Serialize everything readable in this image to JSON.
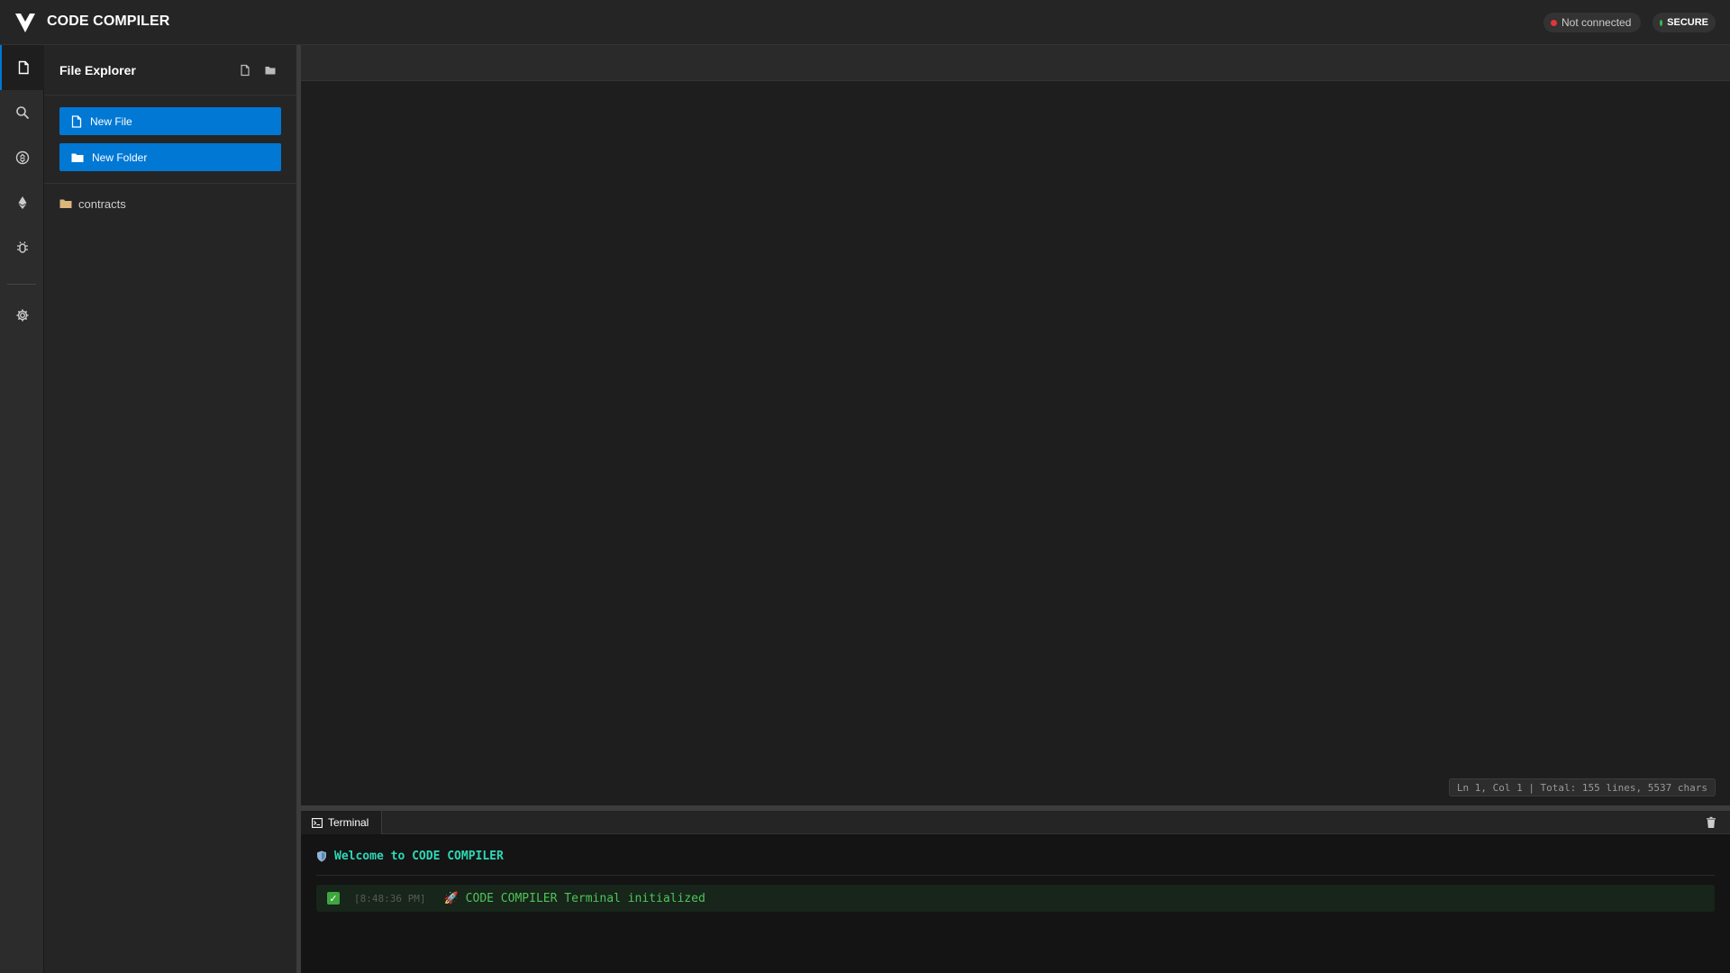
{
  "header": {
    "title": "CODE COMPILER",
    "connection_status": "Not connected",
    "security_badge": "SECURE"
  },
  "activity_bar": {
    "items": [
      "file-explorer",
      "search",
      "compile",
      "deploy",
      "debug",
      "settings"
    ],
    "active": "file-explorer"
  },
  "explorer": {
    "title": "File Explorer",
    "new_file_label": "New File",
    "new_folder_label": "New Folder",
    "tree": [
      {
        "type": "folder",
        "name": "contracts"
      }
    ]
  },
  "editor": {
    "status": "Ln 1, Col 1 | Total: 155 lines, 5537 chars"
  },
  "terminal": {
    "tab_label": "Terminal",
    "welcome": "Welcome to CODE COMPILER",
    "logs": [
      {
        "time": "[8:48:36 PM]",
        "message": "CODE COMPILER Terminal initialized"
      }
    ]
  },
  "colors": {
    "accent": "#0078d4",
    "connection_dot": "#e0363c",
    "secure_dot": "#3fb950",
    "terminal_welcome": "#2ed8b6",
    "log_success": "#4fc35a",
    "folder": "#dcb67a"
  }
}
